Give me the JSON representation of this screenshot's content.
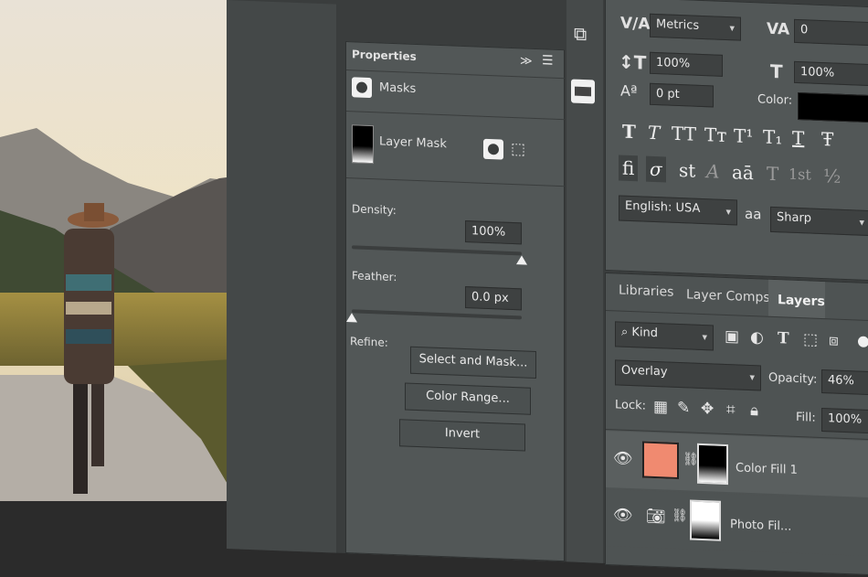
{
  "properties": {
    "title": "Properties",
    "menu": "≫",
    "masks_label": "Masks",
    "layer_mask_label": "Layer Mask",
    "density_label": "Density:",
    "density_value": "100%",
    "density_level": 1.0,
    "feather_label": "Feather:",
    "feather_value": "0.0 px",
    "feather_level": 0.0,
    "refine_label": "Refine:",
    "select_and_mask": "Select and Mask...",
    "color_range": "Color Range...",
    "invert": "Invert"
  },
  "character": {
    "kerning_value": "Metrics",
    "tracking_value": "0",
    "vertical_scale": "100%",
    "horizontal_scale": "100%",
    "baseline_shift": "0 pt",
    "color_label": "Color:",
    "color_value": "#000000",
    "style_buttons": [
      "T",
      "T",
      "TT",
      "Tт",
      "T¹",
      "T₁",
      "T",
      "Ŧ"
    ],
    "opentype_buttons": [
      "fi",
      "σ",
      "st",
      "A",
      "aā",
      "T",
      "1st",
      "½"
    ],
    "language": "English: USA",
    "aa_icon": "aa",
    "antialias": "Sharp"
  },
  "layers_panel": {
    "tabs": [
      "Libraries",
      "Layer Comps",
      "Layers"
    ],
    "active_tab": "Layers",
    "filter_kind": "Kind",
    "blend_mode": "Overlay",
    "opacity_label": "Opacity:",
    "opacity_value": "46%",
    "lock_label": "Lock:",
    "fill_label": "Fill:",
    "fill_value": "100%",
    "layers": [
      {
        "name": "Color Fill 1",
        "swatch": "#f08a70"
      },
      {
        "name": "Photo Fil..."
      }
    ]
  }
}
